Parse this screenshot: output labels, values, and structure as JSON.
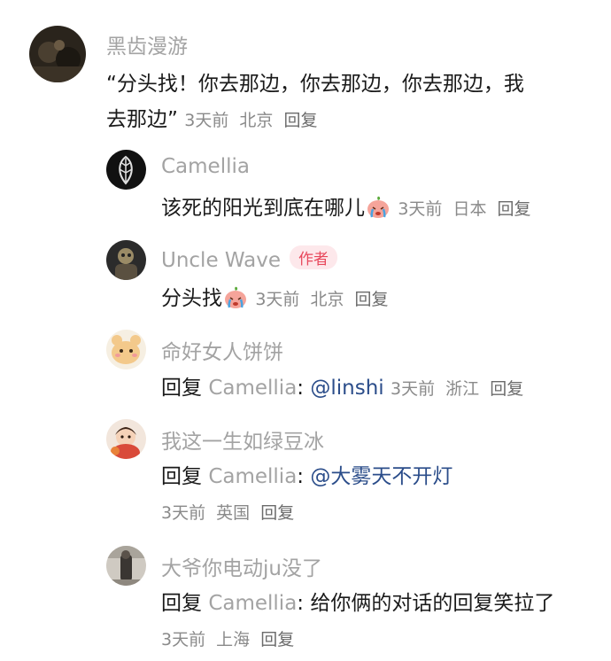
{
  "main_comment": {
    "username": "黑齿漫游",
    "text_line1": "“分头找！你去那边，你去那边，你去那边，我",
    "text_line2": "去那边”",
    "time": "3天前",
    "location": "北京",
    "reply_label": "回复"
  },
  "replies": [
    {
      "username": "Camellia",
      "text": "该死的阳光到底在哪儿",
      "emoji": "crying-peach-emoji",
      "time": "3天前",
      "location": "日本",
      "reply_label": "回复"
    },
    {
      "username": "Uncle Wave",
      "author_tag": "作者",
      "text": "分头找",
      "emoji": "crying-peach-emoji",
      "time": "3天前",
      "location": "北京",
      "reply_label": "回复"
    },
    {
      "username": "命好女人饼饼",
      "reply_prefix": "回复",
      "reply_to": "Camellia",
      "colon": ":",
      "text": "@linshi",
      "time": "3天前",
      "location": "浙江",
      "reply_label": "回复"
    },
    {
      "username": "我这一生如绿豆冰",
      "reply_prefix": "回复",
      "reply_to": "Camellia",
      "colon": ":",
      "text": "@大雾天不开灯",
      "time": "3天前",
      "location": "英国",
      "reply_label": "回复"
    },
    {
      "username": "大爷你电动ju没了",
      "reply_prefix": "回复",
      "reply_to": "Camellia",
      "colon": ":",
      "text": "给你俩的对话的回复笑拉了",
      "time": "3天前",
      "location": "上海",
      "reply_label": "回复"
    }
  ],
  "colors": {
    "username": "#a3a3a3",
    "meta": "#8a8a8a",
    "mention": "#2b4d8a",
    "author_tag_text": "#e8485c",
    "author_tag_bg": "#fde8eb"
  }
}
